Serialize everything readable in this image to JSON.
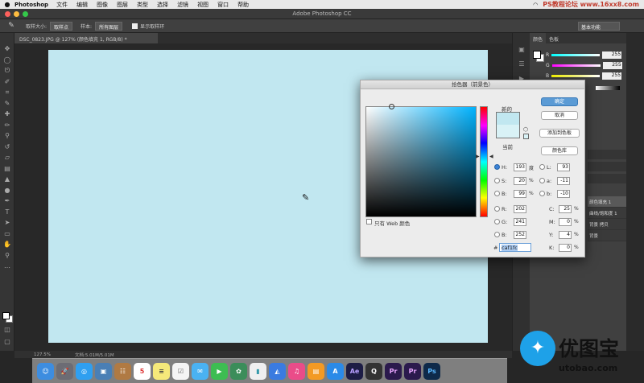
{
  "menubar": {
    "app": "Photoshop",
    "items": [
      "文件",
      "编辑",
      "图像",
      "图层",
      "类型",
      "选择",
      "滤镜",
      "视图",
      "窗口",
      "帮助"
    ],
    "watermark": "PS教程论坛 www.16xx8.com"
  },
  "window": {
    "title": "Adobe Photoshop CC"
  },
  "options": {
    "sample_size_label": "取样大小:",
    "sample_size_value": "取样点",
    "sample_label": "样本:",
    "sample_value": "所有图层",
    "show_ring_label": "显示取样环",
    "workspace": "基本功能"
  },
  "document": {
    "tab": "DSC_0823.JPG @ 127% (颜色填充 1, RGB/8) *",
    "canvas_color": "#c1e7f0",
    "status_zoom": "127.5%",
    "status_doc": "文档:5.01M/5.01M"
  },
  "panels": {
    "tabs": [
      "颜色",
      "色板"
    ],
    "r": "255",
    "g": "255",
    "b": "255",
    "layers": [
      "颜色填充 1",
      "曲线/饱和度 1",
      "背景 拷贝",
      "背景"
    ],
    "r_label": "R",
    "g_label": "G",
    "b_label": "B"
  },
  "picker": {
    "title": "拾色器（前景色）",
    "new_label": "新的",
    "current_label": "当前",
    "ok": "确定",
    "cancel": "取消",
    "add_swatch": "添加到色板",
    "libraries": "颜色库",
    "web_only": "只有 Web 颜色",
    "h_label": "H:",
    "h": "193",
    "h_unit": "度",
    "s_label": "S:",
    "s": "20",
    "s_unit": "%",
    "b_label": "B:",
    "b": "99",
    "b_unit": "%",
    "r_label": "R:",
    "r": "202",
    "g_label": "G:",
    "g": "241",
    "bb_label": "B:",
    "bb": "252",
    "l_label": "L:",
    "l": "93",
    "a_label": "a:",
    "a": "-11",
    "lb_label": "b:",
    "lb": "-10",
    "c_label": "C:",
    "c": "25",
    "c_unit": "%",
    "m_label": "M:",
    "m": "0",
    "m_unit": "%",
    "y_label": "Y:",
    "y": "4",
    "y_unit": "%",
    "k_label": "K:",
    "k": "0",
    "k_unit": "%",
    "hex_label": "#",
    "hex": "caf1fc"
  },
  "dock": {
    "icons": [
      "finder-icon",
      "launchpad-icon",
      "safari-icon",
      "preview-icon",
      "contacts-icon",
      "calendar-icon",
      "notes-icon",
      "reminders-icon",
      "messages-icon",
      "facetime-icon",
      "photos-icon",
      "numbers-icon",
      "keynote-icon",
      "itunes-icon",
      "ibooks-icon",
      "appstore-icon",
      "ae-icon",
      "quicktime-icon",
      "premiere-icon",
      "premiere2-icon",
      "photoshop-icon"
    ],
    "calendar_day": "5",
    "ae_label": "Ae",
    "pr_label": "Pr",
    "ps_label": "Ps"
  },
  "logo": {
    "name": "优图宝",
    "url": "utobao.com"
  }
}
